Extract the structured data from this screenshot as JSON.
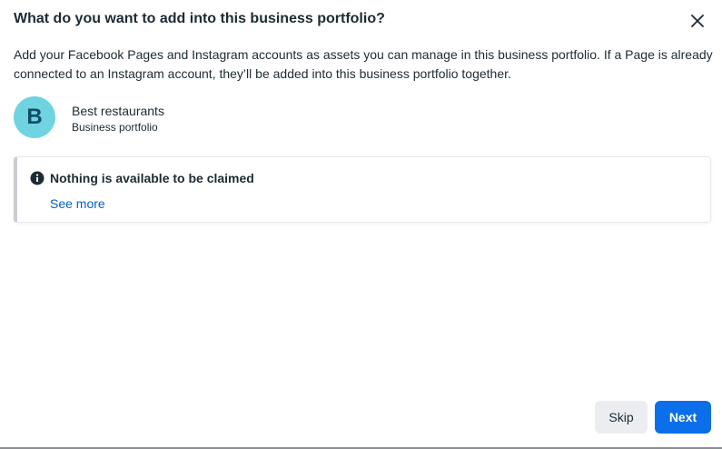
{
  "dialog": {
    "title": "What do you want to add into this business portfolio?",
    "description": "Add your Facebook Pages and Instagram accounts as assets you can manage in this business portfolio. If a Page is already connected to an Instagram account, they’ll be added into this business portfolio together.",
    "close_icon": "close-icon"
  },
  "portfolio": {
    "avatar_letter": "B",
    "avatar_color": "#6fd3e0",
    "name": "Best restaurants",
    "type": "Business portfolio"
  },
  "notice": {
    "icon": "info-icon",
    "title": "Nothing is available to be claimed",
    "link": "See more"
  },
  "footer": {
    "skip_label": "Skip",
    "next_label": "Next"
  },
  "colors": {
    "primary": "#0a6fe8",
    "link": "#0a5fc6",
    "secondary_button": "#ebedf0",
    "text": "#1c2b33"
  }
}
